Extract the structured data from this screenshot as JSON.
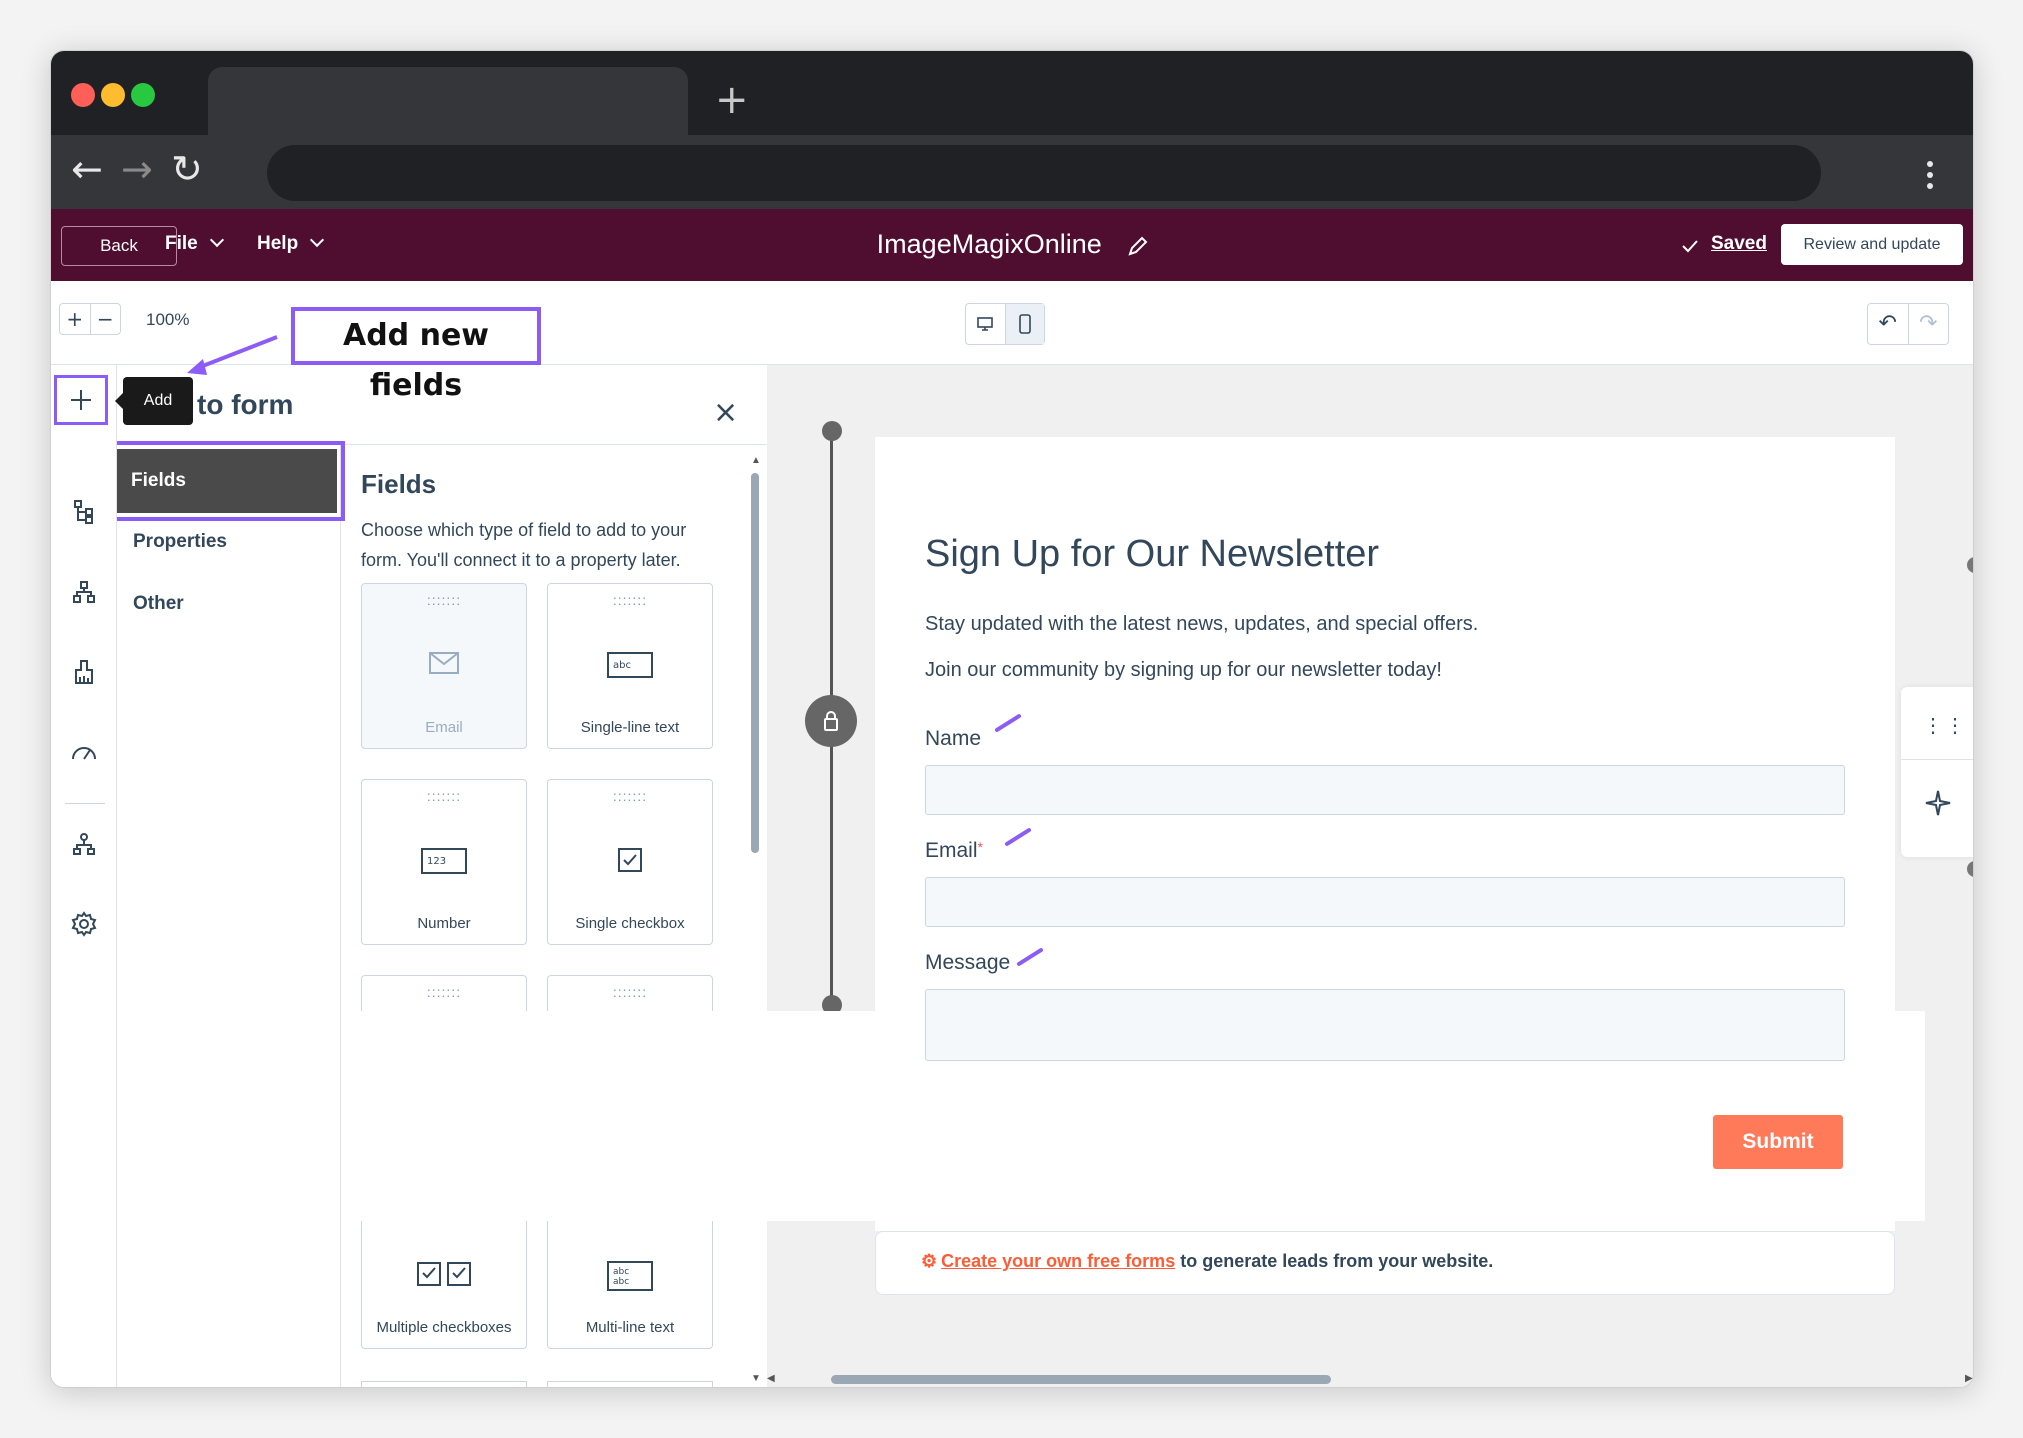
{
  "browser": {
    "traffic_lights": [
      "#fe5f57",
      "#febc2e",
      "#28c840"
    ]
  },
  "header": {
    "back_label": "Back",
    "file_label": "File",
    "help_label": "Help",
    "title": "ImageMagixOnline",
    "saved_label": "Saved",
    "review_label": "Review and update",
    "bg_color": "#4f0e2f"
  },
  "toolbar": {
    "zoom_in": "+",
    "zoom_out": "−",
    "zoom_level": "100%"
  },
  "annotation": {
    "callout_text": "Add new fields",
    "color": "#8b5cf6"
  },
  "rail": {
    "tooltip": "Add",
    "icons": [
      "add-icon",
      "tree-icon",
      "hierarchy-icon",
      "brush-icon",
      "speedometer-icon",
      "network-icon",
      "settings-icon"
    ]
  },
  "panel": {
    "title": "to form",
    "categories": [
      "Fields",
      "Properties",
      "Other"
    ],
    "fields_heading": "Fields",
    "fields_description": "Choose which type of field to add to your form. You'll connect it to a property later.",
    "cards": [
      {
        "label": "Email",
        "disabled": true
      },
      {
        "label": "Single-line text",
        "disabled": false
      },
      {
        "label": "Number",
        "disabled": false
      },
      {
        "label": "Single checkbox",
        "disabled": false
      },
      {
        "label": "Multiple checkboxes",
        "disabled": false
      },
      {
        "label": "Multi-line text",
        "disabled": false
      }
    ]
  },
  "form": {
    "title": "Sign Up for Our Newsletter",
    "paragraph1": "Stay updated with the latest news, updates, and special offers.",
    "paragraph2": "Join our community by signing up for our newsletter today!",
    "name_label": "Name",
    "email_label": "Email",
    "email_required": "*",
    "message_label": "Message",
    "submit_label": "Submit",
    "submit_color": "#ff7a59",
    "footer_link": "Create your own free forms",
    "footer_text": " to generate leads from your website."
  }
}
